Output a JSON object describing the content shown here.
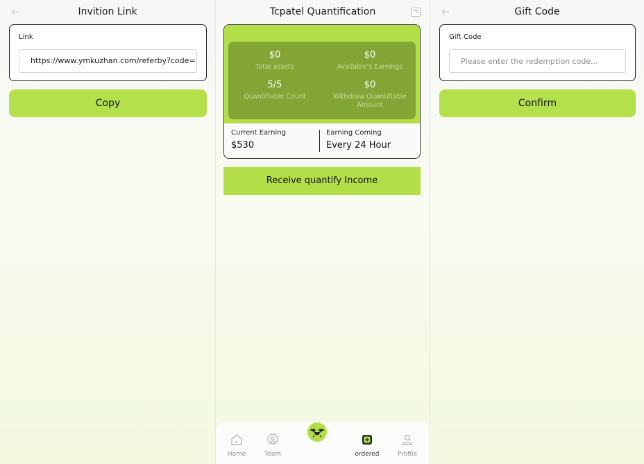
{
  "invite": {
    "title": "Invition Link",
    "link_label": "Link",
    "link_value": "https://www.ymkuzhan.com/referby?code=",
    "copy_label": "Copy"
  },
  "quant": {
    "title": "Tcpatel Quantification",
    "total_assets_value": "$0",
    "total_assets_label": "Total assets",
    "available_value": "$0",
    "available_label": "Available's Earnings",
    "count_value": "5/5",
    "count_label": "Quantifiable Count",
    "withdraw_value": "$0",
    "withdraw_label": "Withdraw Quantifiable Amount",
    "current_label": "Current Earning",
    "current_value": "$530",
    "coming_label": "Earning Coming",
    "coming_value": "Every 24 Hour",
    "receive_label": "Receive quantify Income"
  },
  "tabs": {
    "home": "Home",
    "team": "Team",
    "ordered": "ordered",
    "profile": "Profile"
  },
  "gift": {
    "title": "Gift Code",
    "field_label": "Gift Code",
    "placeholder": "Please enter the redemption code...",
    "confirm_label": "Confirm"
  },
  "colors": {
    "accent": "#b4e04b",
    "accent_dark": "#83a535"
  },
  "icons": [
    "back-arrow-icon",
    "menu-icon",
    "home-icon",
    "team-icon",
    "drone-icon",
    "ordered-icon",
    "profile-icon"
  ]
}
